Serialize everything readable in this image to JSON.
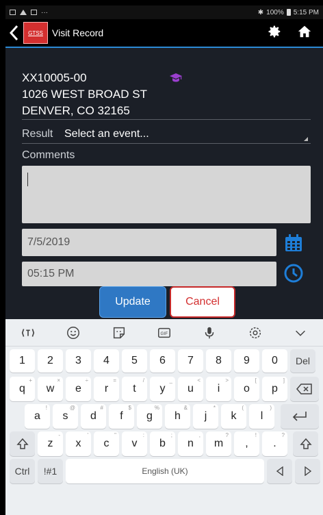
{
  "status": {
    "time": "5:15 PM",
    "battery": "100%",
    "bluetooth_icon": "bluetooth-icon",
    "dots": "···"
  },
  "appbar": {
    "logo_text": "GTSS",
    "title": "Visit Record",
    "settings_icon": "gear-icon",
    "home_icon": "home-icon"
  },
  "record": {
    "account": "XX10005-00",
    "street": "1026 WEST BROAD ST",
    "city": "DENVER, CO 32165"
  },
  "form": {
    "result_label": "Result",
    "result_value": "Select an event...",
    "comments_label": "Comments",
    "comments_value": "",
    "date_value": "7/5/2019",
    "time_value": "05:15 PM"
  },
  "buttons": {
    "update": "Update",
    "cancel": "Cancel"
  },
  "keyboard": {
    "number_row": [
      "1",
      "2",
      "3",
      "4",
      "5",
      "6",
      "7",
      "8",
      "9",
      "0",
      "Del"
    ],
    "row1": [
      {
        "key": "q",
        "sup": "+"
      },
      {
        "key": "w",
        "sup": "×"
      },
      {
        "key": "e",
        "sup": "÷"
      },
      {
        "key": "r",
        "sup": "="
      },
      {
        "key": "t",
        "sup": "/"
      },
      {
        "key": "y",
        "sup": "_"
      },
      {
        "key": "u",
        "sup": "<"
      },
      {
        "key": "i",
        "sup": ">"
      },
      {
        "key": "o",
        "sup": "["
      },
      {
        "key": "p",
        "sup": "]"
      }
    ],
    "row2": [
      {
        "key": "a",
        "sup": "!"
      },
      {
        "key": "s",
        "sup": "@"
      },
      {
        "key": "d",
        "sup": "#"
      },
      {
        "key": "f",
        "sup": "$"
      },
      {
        "key": "g",
        "sup": "%"
      },
      {
        "key": "h",
        "sup": "&"
      },
      {
        "key": "j",
        "sup": "*"
      },
      {
        "key": "k",
        "sup": "("
      },
      {
        "key": "l",
        "sup": ")"
      }
    ],
    "row3": [
      {
        "key": "z",
        "sup": "-"
      },
      {
        "key": "x",
        "sup": "'"
      },
      {
        "key": "c",
        "sup": "\""
      },
      {
        "key": "v",
        "sup": ":"
      },
      {
        "key": "b",
        "sup": ";"
      },
      {
        "key": "n",
        "sup": ","
      },
      {
        "key": "m",
        "sup": "?"
      }
    ],
    "comma": ",",
    "comma_sup": "!",
    "period": ".",
    "period_sup": "?",
    "ctrl": "Ctrl",
    "symbols": "!#1",
    "space_label": "English (UK)"
  }
}
